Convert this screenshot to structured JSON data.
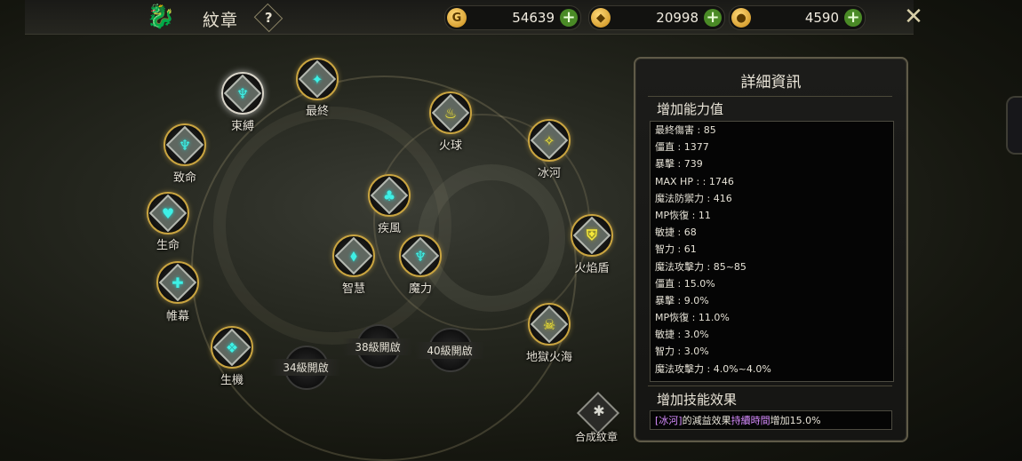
{
  "header": {
    "title": "紋章",
    "help_symbol": "?",
    "currencies": [
      {
        "icon": "gold-coin-icon",
        "value": "54639"
      },
      {
        "icon": "diamond-coin-icon",
        "value": "20998"
      },
      {
        "icon": "medal-coin-icon",
        "value": "4590"
      }
    ],
    "plus_symbol": "+"
  },
  "emblems": [
    {
      "name": "束縛",
      "color": "cyan",
      "selected": true
    },
    {
      "name": "最終",
      "color": "cyan"
    },
    {
      "name": "致命",
      "color": "cyan"
    },
    {
      "name": "生命",
      "color": "cyan"
    },
    {
      "name": "帷幕",
      "color": "cyan"
    },
    {
      "name": "生機",
      "color": "cyan"
    },
    {
      "name": "疾風",
      "color": "cyan"
    },
    {
      "name": "智慧",
      "color": "cyan"
    },
    {
      "name": "魔力",
      "color": "cyan"
    },
    {
      "name": "火球",
      "color": "yellow"
    },
    {
      "name": "冰河",
      "color": "yellow"
    },
    {
      "name": "火焰盾",
      "color": "yellow"
    },
    {
      "name": "地獄火海",
      "color": "yellow"
    }
  ],
  "locked_slots": [
    "34級開啟",
    "38級開啟",
    "40級開啟"
  ],
  "compose_label": "合成紋章",
  "panel": {
    "title": "詳細資訊",
    "stats_heading": "增加能力值",
    "stats": [
      "最終傷害 : 85",
      "僵直 : 1377",
      "暴擊 : 739",
      "MAX HP : : 1746",
      "魔法防禦力 : 416",
      "MP恢復 : 11",
      "敏捷 : 68",
      "智力 : 61",
      "魔法攻擊力 : 85~85",
      "僵直 : 15.0%",
      "暴擊 : 9.0%",
      "MP恢復 : 11.0%",
      "敏捷 : 3.0%",
      "智力 : 3.0%",
      "魔法攻擊力 : 4.0%~4.0%"
    ],
    "skill_heading": "增加技能效果",
    "skill_effect": {
      "part1": "[冰河]",
      "part2": "的減益效果",
      "part3": "持續時間",
      "part4": "增加15.0%"
    }
  },
  "colors": {
    "accent_gold": "#c9a440",
    "cyan_glyph": "#3ef0e6",
    "yellow_glyph": "#f6e93a",
    "highlight_purple": "#d78cff"
  }
}
